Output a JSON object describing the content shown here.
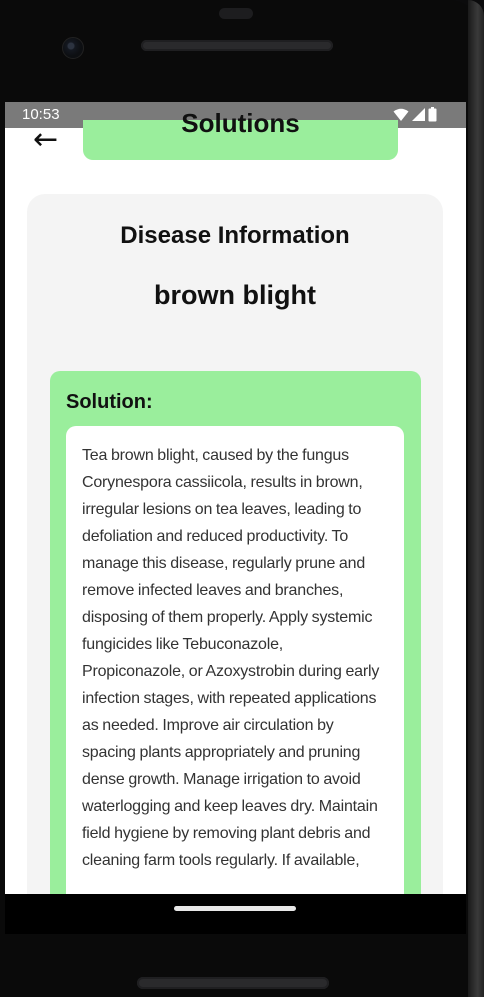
{
  "status_bar": {
    "time": "10:53",
    "icons": [
      "wifi-icon",
      "signal-icon",
      "battery-icon"
    ]
  },
  "header": {
    "back_label": "←",
    "title": "Solutions"
  },
  "card": {
    "heading": "Disease Information",
    "disease_name": "brown blight",
    "solution_label": "Solution:",
    "solution_text": "Tea brown blight, caused by the fungus Corynespora cassiicola, results in brown, irregular lesions on tea leaves, leading to defoliation and reduced productivity. To manage this disease, regularly prune and remove infected leaves and branches, disposing of them properly. Apply systemic fungicides like Tebuconazole, Propiconazole, or Azoxystrobin during early infection stages, with repeated applications as needed. Improve air circulation by spacing plants appropriately and pruning dense growth. Manage irrigation to avoid waterlogging and keep leaves dry. Maintain field hygiene by removing plant debris and cleaning farm tools regularly. If available,"
  },
  "colors": {
    "accent_green": "#9aee9c",
    "card_bg": "#f4f4f4",
    "status_bar": "#7a7a7a"
  }
}
